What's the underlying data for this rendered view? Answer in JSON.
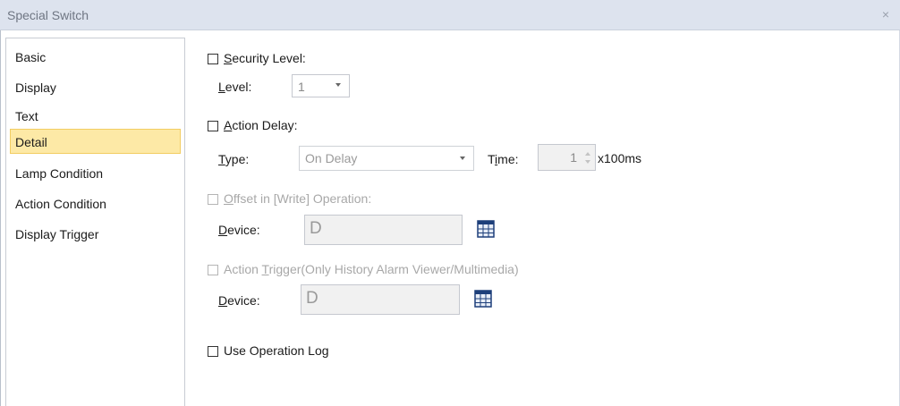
{
  "window": {
    "title": "Special Switch",
    "close_glyph": "×"
  },
  "sidebar": {
    "items": [
      {
        "label": "Basic",
        "selected": false
      },
      {
        "label": "Display",
        "selected": false
      },
      {
        "label": "Text",
        "selected": false
      },
      {
        "label": "Detail",
        "selected": true
      },
      {
        "label": "Lamp Condition",
        "selected": false
      },
      {
        "label": "Action Condition",
        "selected": false
      },
      {
        "label": "Display Trigger",
        "selected": false
      }
    ],
    "selected_color": "#fde9a6"
  },
  "detail": {
    "security": {
      "checkbox_label_key": "S",
      "checkbox_label_rest": "ecurity Level:",
      "checked": false,
      "level_label_key": "L",
      "level_label_rest": "evel:",
      "level_value": "1"
    },
    "action_delay": {
      "checkbox_label_key": "A",
      "checkbox_label_rest": "ction Delay:",
      "checked": false,
      "type_label_key": "T",
      "type_label_rest": "ype:",
      "type_value": "On Delay",
      "time_label_prefix": "T",
      "time_label_key": "i",
      "time_label_rest": "me:",
      "time_value": "1",
      "time_unit": "x100ms"
    },
    "offset": {
      "checkbox_label_key": "O",
      "checkbox_label_rest": "ffset in [Write] Operation:",
      "checked": false,
      "enabled": false,
      "device_label_key": "D",
      "device_label_rest": "evice:",
      "device_value": "D",
      "button_icon": "table-icon"
    },
    "action_trigger": {
      "checkbox_label_prefix": "Action ",
      "checkbox_label_key": "T",
      "checkbox_label_rest": "rigger(Only History Alarm Viewer/Multimedia)",
      "checked": false,
      "enabled": false,
      "device_label_key": "D",
      "device_label_rest": "evice:",
      "device_value": "D",
      "button_icon": "table-icon"
    },
    "operation_log": {
      "checkbox_label": "Use Operation Log",
      "checked": false
    }
  }
}
